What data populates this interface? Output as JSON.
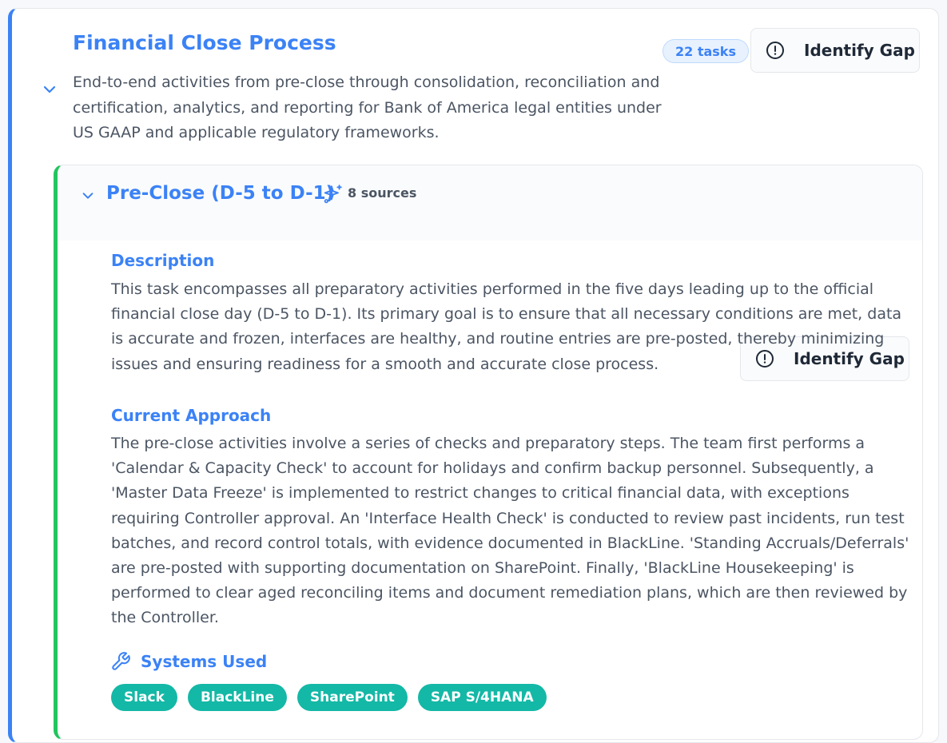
{
  "process": {
    "title": "Financial Close Process",
    "description": "End-to-end activities from pre-close through consolidation, reconciliation and certification, analytics, and reporting for Bank of America legal entities under US GAAP and applicable regulatory frameworks.",
    "task_count": "22 tasks",
    "identify_gap_label": "Identify Gap"
  },
  "task": {
    "title": "Pre-Close (D-5 to D-1)",
    "sources": "8 sources",
    "identify_gap_label": "Identify Gap",
    "description_heading": "Description",
    "description": "This task encompasses all preparatory activities performed in the five days leading up to the official financial close day (D-5 to D-1). Its primary goal is to ensure that all necessary conditions are met, data is accurate and frozen, interfaces are healthy, and routine entries are pre-posted, thereby minimizing issues and ensuring readiness for a smooth and accurate close process.",
    "approach_heading": "Current Approach",
    "approach": "The pre-close activities involve a series of checks and preparatory steps. The team first performs a 'Calendar & Capacity Check' to account for holidays and confirm backup personnel. Subsequently, a 'Master Data Freeze' is implemented to restrict changes to critical financial data, with exceptions requiring Controller approval. An 'Interface Health Check' is conducted to review past incidents, run test batches, and record control totals, with evidence documented in BlackLine. 'Standing Accruals/Deferrals' are pre-posted with supporting documentation on SharePoint. Finally, 'BlackLine Housekeeping' is performed to clear aged reconciling items and document remediation plans, which are then reviewed by the Controller.",
    "systems_heading": "Systems Used",
    "systems": [
      "Slack",
      "BlackLine",
      "SharePoint",
      "SAP S/4HANA"
    ]
  },
  "icons": {
    "collapse": "chevron-down-icon",
    "alert": "alert-circle-icon",
    "sources": "sparkles-icon",
    "systems": "wrench-icon"
  },
  "colors": {
    "process_accent": "#3b82f6",
    "task_accent": "#22c55e",
    "chip": "#14b8a6"
  }
}
